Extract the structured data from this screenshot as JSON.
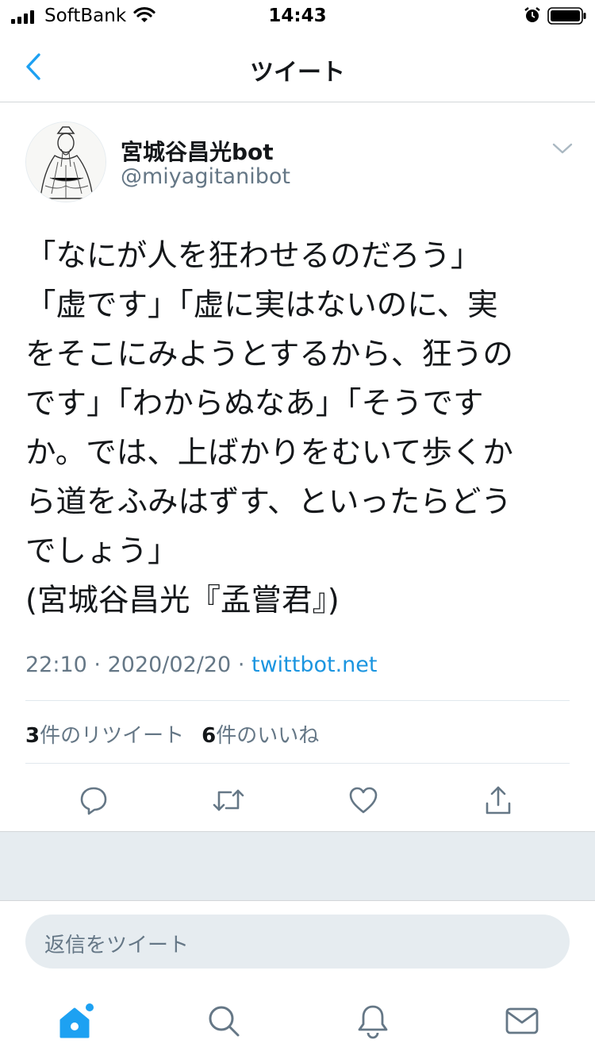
{
  "status_bar": {
    "carrier": "SoftBank",
    "time": "14:43"
  },
  "nav": {
    "title": "ツイート"
  },
  "tweet": {
    "display_name": "宮城谷昌光bot",
    "handle": "@miyagitanibot",
    "text_lines": [
      "「なにが人を狂わせるのだろう」",
      "「虚です」「虚に実はないのに、実",
      "をそこにみようとするから、狂うの",
      "です」「わからぬなあ」「そうです",
      "か。では、上ばかりをむいて歩くか",
      "ら道をふみはずす、といったらどう",
      "でしょう」",
      "(宮城谷昌光『孟嘗君』)"
    ],
    "time": "22:10",
    "separator": "·",
    "date": "2020/02/20",
    "source": "twittbot.net"
  },
  "stats": {
    "retweets_count": "3",
    "retweets_label": "件のリツイート",
    "likes_count": "6",
    "likes_label": "件のいいね"
  },
  "reply": {
    "placeholder": "返信をツイート"
  },
  "colors": {
    "accent": "#1da1f2",
    "link": "#1b95e0",
    "secondary_text": "#657786",
    "primary_text": "#14171a",
    "background_gray": "#e6ecf0"
  },
  "icons": {
    "actions": [
      "reply-icon",
      "retweet-icon",
      "like-icon",
      "share-icon"
    ],
    "tabs": [
      "home-icon",
      "search-icon",
      "notifications-icon",
      "messages-icon"
    ]
  }
}
